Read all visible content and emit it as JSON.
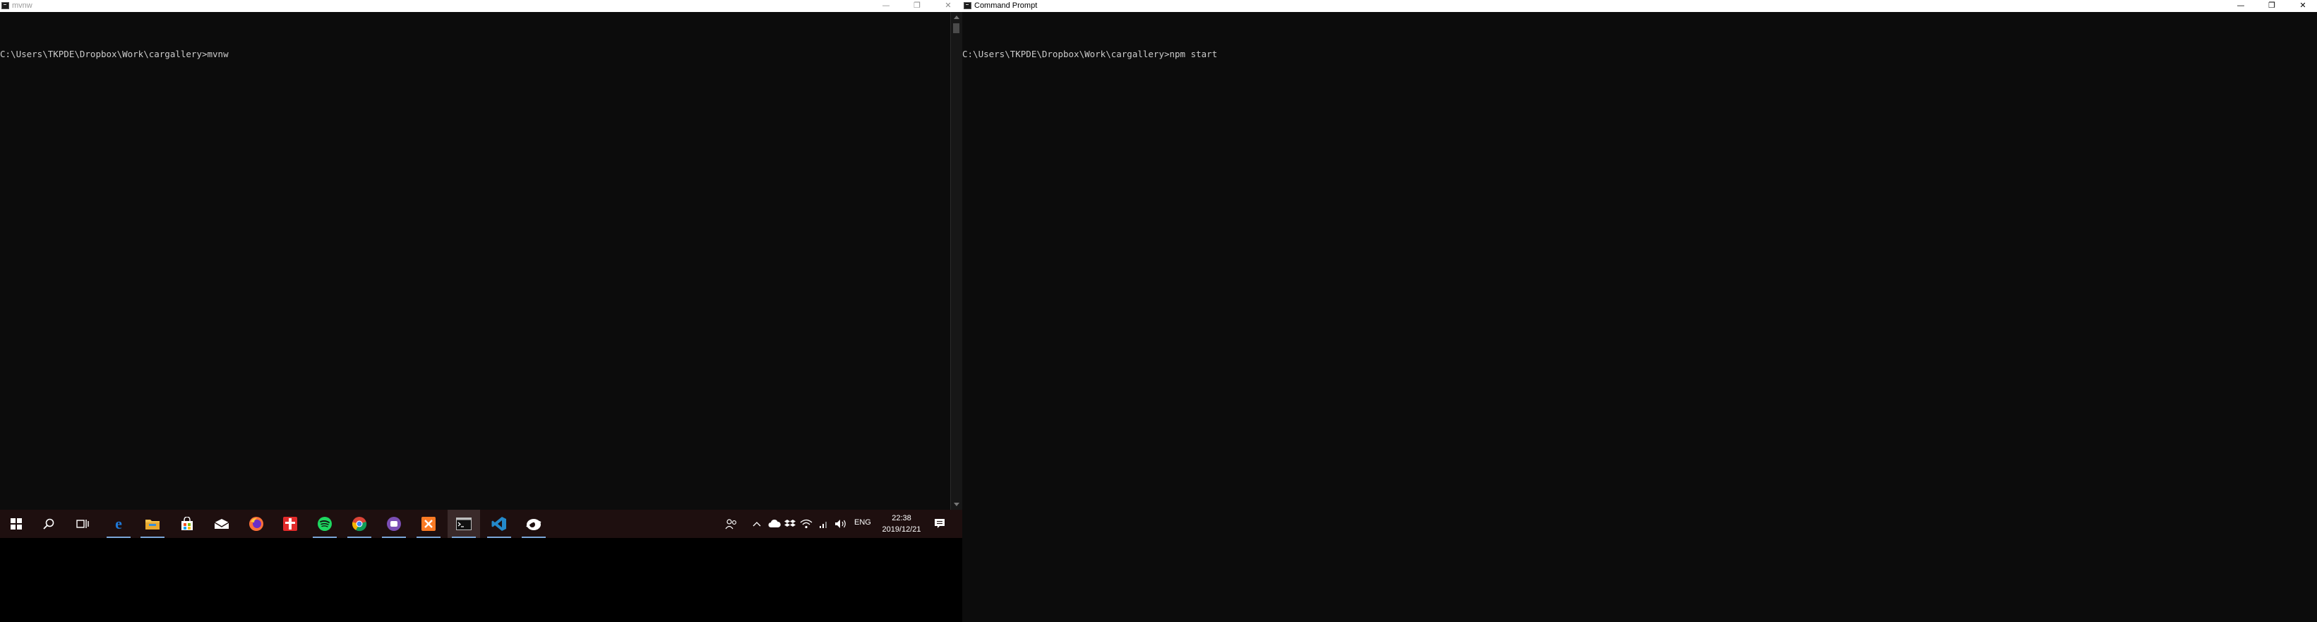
{
  "left_window": {
    "title": "mvnw",
    "controls": {
      "minimize": "—",
      "maximize": "❐",
      "close": "✕"
    },
    "lines": [
      "C:\\Users\\TKPDE\\Dropbox\\Work\\cargallery>mvnw"
    ]
  },
  "right_window": {
    "title": "Command Prompt",
    "controls": {
      "minimize": "—",
      "maximize": "❐",
      "close": "✕"
    },
    "lines": [
      "C:\\Users\\TKPDE\\Dropbox\\Work\\cargallery>npm start"
    ]
  },
  "taskbar": {
    "apps": [
      {
        "name": "windows-start-icon"
      },
      {
        "name": "search-icon"
      },
      {
        "name": "task-view-icon"
      },
      {
        "name": "edge-icon"
      },
      {
        "name": "file-explorer-icon"
      },
      {
        "name": "store-icon"
      },
      {
        "name": "mail-icon"
      },
      {
        "name": "firefox-icon"
      },
      {
        "name": "gift-app-icon"
      },
      {
        "name": "spotify-icon"
      },
      {
        "name": "chrome-icon"
      },
      {
        "name": "media-app-icon"
      },
      {
        "name": "xampp-icon"
      },
      {
        "name": "command-prompt-icon"
      },
      {
        "name": "vscode-icon"
      },
      {
        "name": "browser-app-icon"
      }
    ],
    "tray": {
      "language": "ENG",
      "time": "22:38",
      "date": "2019/12/21"
    }
  },
  "colors": {
    "console_bg": "#0c0c0c",
    "console_text": "#cccccc",
    "taskbar_bg": "#1e0f0f",
    "active_underline": "#7aa6d9"
  }
}
